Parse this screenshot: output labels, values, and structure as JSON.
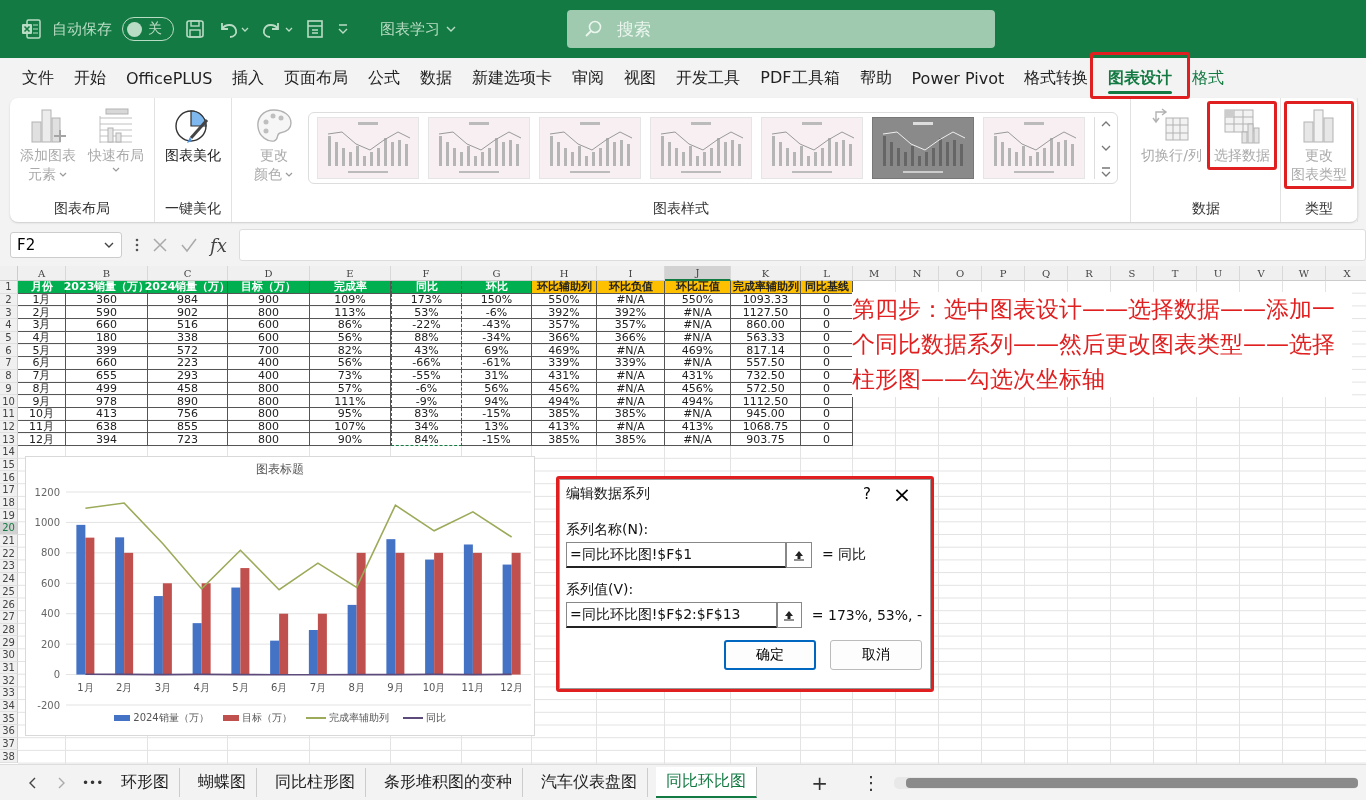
{
  "title_bar": {
    "autosave_label": "自动保存",
    "autosave_toggle": {
      "on": false,
      "label": "关"
    },
    "document_title": "图表学习",
    "search": {
      "placeholder": "搜索"
    }
  },
  "ribbon_tabs": [
    {
      "label": "文件",
      "selected": false,
      "contextual": false,
      "highlighted": false
    },
    {
      "label": "开始",
      "selected": false,
      "contextual": false,
      "highlighted": false
    },
    {
      "label": "OfficePLUS",
      "selected": false,
      "contextual": false,
      "highlighted": false
    },
    {
      "label": "插入",
      "selected": false,
      "contextual": false,
      "highlighted": false
    },
    {
      "label": "页面布局",
      "selected": false,
      "contextual": false,
      "highlighted": false
    },
    {
      "label": "公式",
      "selected": false,
      "contextual": false,
      "highlighted": false
    },
    {
      "label": "数据",
      "selected": false,
      "contextual": false,
      "highlighted": false
    },
    {
      "label": "新建选项卡",
      "selected": false,
      "contextual": false,
      "highlighted": false
    },
    {
      "label": "审阅",
      "selected": false,
      "contextual": false,
      "highlighted": false
    },
    {
      "label": "视图",
      "selected": false,
      "contextual": false,
      "highlighted": false
    },
    {
      "label": "开发工具",
      "selected": false,
      "contextual": false,
      "highlighted": false
    },
    {
      "label": "PDF工具箱",
      "selected": false,
      "contextual": false,
      "highlighted": false
    },
    {
      "label": "帮助",
      "selected": false,
      "contextual": false,
      "highlighted": false
    },
    {
      "label": "Power Pivot",
      "selected": false,
      "contextual": false,
      "highlighted": false
    },
    {
      "label": "格式转换",
      "selected": false,
      "contextual": false,
      "highlighted": false
    },
    {
      "label": "图表设计",
      "selected": true,
      "contextual": true,
      "highlighted": true
    },
    {
      "label": "格式",
      "selected": false,
      "contextual": true,
      "highlighted": false
    }
  ],
  "ribbon_groups": [
    {
      "label": "图表布局",
      "items": [
        {
          "kind": "add-element",
          "lines": [
            "添加图表",
            "元素"
          ],
          "disabled": true,
          "dropdown": true,
          "highlighted": false
        },
        {
          "kind": "quick-layout",
          "lines": [
            "快速布局"
          ],
          "disabled": true,
          "dropdown": true,
          "highlighted": false
        }
      ]
    },
    {
      "label": "一键美化",
      "items": [
        {
          "kind": "beautify",
          "lines": [
            "图表美化"
          ],
          "disabled": false,
          "dropdown": false,
          "highlighted": false
        }
      ]
    },
    {
      "label": "图表样式",
      "items": [
        {
          "kind": "colors",
          "lines": [
            "更改",
            "颜色"
          ],
          "disabled": true,
          "dropdown": true,
          "highlighted": false
        },
        {
          "kind": "gallery",
          "thumbnails": [
            {
              "dark": false
            },
            {
              "dark": false
            },
            {
              "dark": false
            },
            {
              "dark": false
            },
            {
              "dark": false
            },
            {
              "dark": true
            },
            {
              "dark": false
            }
          ]
        }
      ]
    },
    {
      "label": "数据",
      "items": [
        {
          "kind": "switch-row-col",
          "lines": [
            "切换行/列"
          ],
          "disabled": true,
          "dropdown": false,
          "highlighted": false
        },
        {
          "kind": "select-data",
          "lines": [
            "选择数据"
          ],
          "disabled": true,
          "dropdown": false,
          "highlighted": true
        }
      ]
    },
    {
      "label": "类型",
      "items": [
        {
          "kind": "change-type",
          "lines": [
            "更改",
            "图表类型"
          ],
          "disabled": true,
          "dropdown": false,
          "highlighted": true
        }
      ]
    }
  ],
  "formula_bar": {
    "name_box": "F2",
    "fx": "fx"
  },
  "columns": [
    {
      "label": "A",
      "selected": false
    },
    {
      "label": "B",
      "selected": false
    },
    {
      "label": "C",
      "selected": false
    },
    {
      "label": "D",
      "selected": false
    },
    {
      "label": "E",
      "selected": false
    },
    {
      "label": "F",
      "selected": false
    },
    {
      "label": "G",
      "selected": false
    },
    {
      "label": "H",
      "selected": false
    },
    {
      "label": "I",
      "selected": false
    },
    {
      "label": "J",
      "selected": true
    },
    {
      "label": "K",
      "selected": false
    },
    {
      "label": "L",
      "selected": false
    },
    {
      "label": "M",
      "selected": false
    },
    {
      "label": "N",
      "selected": false
    },
    {
      "label": "O",
      "selected": false
    },
    {
      "label": "P",
      "selected": false
    },
    {
      "label": "Q",
      "selected": false
    },
    {
      "label": "R",
      "selected": false
    },
    {
      "label": "S",
      "selected": false
    },
    {
      "label": "T",
      "selected": false
    },
    {
      "label": "U",
      "selected": false
    },
    {
      "label": "V",
      "selected": false
    },
    {
      "label": "W",
      "selected": false
    },
    {
      "label": "X",
      "selected": false
    }
  ],
  "row_numbers": [
    {
      "label": "1",
      "selected": false
    },
    {
      "label": "2",
      "selected": false
    },
    {
      "label": "3",
      "selected": false
    },
    {
      "label": "4",
      "selected": false
    },
    {
      "label": "5",
      "selected": false
    },
    {
      "label": "6",
      "selected": false
    },
    {
      "label": "7",
      "selected": false
    },
    {
      "label": "8",
      "selected": false
    },
    {
      "label": "9",
      "selected": false
    },
    {
      "label": "10",
      "selected": false
    },
    {
      "label": "11",
      "selected": false
    },
    {
      "label": "12",
      "selected": false
    },
    {
      "label": "13",
      "selected": false
    },
    {
      "label": "14",
      "selected": false
    },
    {
      "label": "15",
      "selected": false
    },
    {
      "label": "16",
      "selected": false
    },
    {
      "label": "17",
      "selected": false
    },
    {
      "label": "18",
      "selected": false
    },
    {
      "label": "19",
      "selected": false
    },
    {
      "label": "20",
      "selected": true
    },
    {
      "label": "21",
      "selected": false
    },
    {
      "label": "22",
      "selected": false
    },
    {
      "label": "23",
      "selected": false
    },
    {
      "label": "24",
      "selected": false
    },
    {
      "label": "25",
      "selected": false
    },
    {
      "label": "26",
      "selected": false
    },
    {
      "label": "27",
      "selected": false
    },
    {
      "label": "28",
      "selected": false
    },
    {
      "label": "29",
      "selected": false
    },
    {
      "label": "30",
      "selected": false
    },
    {
      "label": "31",
      "selected": false
    },
    {
      "label": "32",
      "selected": false
    },
    {
      "label": "33",
      "selected": false
    },
    {
      "label": "34",
      "selected": false
    },
    {
      "label": "35",
      "selected": false
    },
    {
      "label": "36",
      "selected": false
    },
    {
      "label": "37",
      "selected": false
    },
    {
      "label": "38",
      "selected": false
    }
  ],
  "table": {
    "header": [
      {
        "text": "月份",
        "color": "#00b050",
        "marquee": false
      },
      {
        "text": "2023销量（万）",
        "color": "#00b050",
        "marquee": false
      },
      {
        "text": "2024销量（万）",
        "color": "#00b050",
        "marquee": false
      },
      {
        "text": "目标（万）",
        "color": "#00b050",
        "marquee": false
      },
      {
        "text": "完成率",
        "color": "#00b050",
        "marquee": false
      },
      {
        "text": "同比",
        "color": "#00b050",
        "marquee": true
      },
      {
        "text": "环比",
        "color": "#00b050",
        "marquee": false
      },
      {
        "text": "环比辅助列",
        "color": "#ffc000",
        "marquee": false
      },
      {
        "text": "环比负值",
        "color": "#ffc000",
        "marquee": false
      },
      {
        "text": "环比正值",
        "color": "#ffc000",
        "marquee": false
      },
      {
        "text": "完成率辅助列",
        "color": "#ffc000",
        "marquee": false
      },
      {
        "text": "同比基线",
        "color": "#ffc000",
        "marquee": false
      }
    ],
    "rows": [
      [
        "1月",
        "360",
        "984",
        "900",
        "109%",
        "173%",
        "150%",
        "550%",
        "#N/A",
        "550%",
        "1093.33",
        "0"
      ],
      [
        "2月",
        "590",
        "902",
        "800",
        "113%",
        "53%",
        "-6%",
        "392%",
        "392%",
        "#N/A",
        "1127.50",
        "0"
      ],
      [
        "3月",
        "660",
        "516",
        "600",
        "86%",
        "-22%",
        "-43%",
        "357%",
        "357%",
        "#N/A",
        "860.00",
        "0"
      ],
      [
        "4月",
        "180",
        "338",
        "600",
        "56%",
        "88%",
        "-34%",
        "366%",
        "366%",
        "#N/A",
        "563.33",
        "0"
      ],
      [
        "5月",
        "399",
        "572",
        "700",
        "82%",
        "43%",
        "69%",
        "469%",
        "#N/A",
        "469%",
        "817.14",
        "0"
      ],
      [
        "6月",
        "660",
        "223",
        "400",
        "56%",
        "-66%",
        "-61%",
        "339%",
        "339%",
        "#N/A",
        "557.50",
        "0"
      ],
      [
        "7月",
        "655",
        "293",
        "400",
        "73%",
        "-55%",
        "31%",
        "431%",
        "#N/A",
        "431%",
        "732.50",
        "0"
      ],
      [
        "8月",
        "499",
        "458",
        "800",
        "57%",
        "-6%",
        "56%",
        "456%",
        "#N/A",
        "456%",
        "572.50",
        "0"
      ],
      [
        "9月",
        "978",
        "890",
        "800",
        "111%",
        "-9%",
        "94%",
        "494%",
        "#N/A",
        "494%",
        "1112.50",
        "0"
      ],
      [
        "10月",
        "413",
        "756",
        "800",
        "95%",
        "83%",
        "-15%",
        "385%",
        "385%",
        "#N/A",
        "945.00",
        "0"
      ],
      [
        "11月",
        "638",
        "855",
        "800",
        "107%",
        "34%",
        "13%",
        "413%",
        "#N/A",
        "413%",
        "1068.75",
        "0"
      ],
      [
        "12月",
        "394",
        "723",
        "800",
        "90%",
        "84%",
        "-15%",
        "385%",
        "385%",
        "#N/A",
        "903.75",
        "0"
      ]
    ]
  },
  "annotation": "第四步：选中图表设计——选择数据——添加一个同比数据系列——然后更改图表类型——选择柱形图——勾选次坐标轴",
  "chart": {
    "chart_data": {
      "type": "bar",
      "title": "图表标题",
      "categories": [
        "1月",
        "2月",
        "3月",
        "4月",
        "5月",
        "6月",
        "7月",
        "8月",
        "9月",
        "10月",
        "11月",
        "12月"
      ],
      "ylim": [
        -200,
        1200
      ],
      "grid": true,
      "legend": true,
      "yticks": [
        {
          "value": -200,
          "label": "-200"
        },
        {
          "value": 0,
          "label": "0"
        },
        {
          "value": 200,
          "label": "200"
        },
        {
          "value": 400,
          "label": "400"
        },
        {
          "value": 600,
          "label": "600"
        },
        {
          "value": 800,
          "label": "800"
        },
        {
          "value": 1000,
          "label": "1000"
        },
        {
          "value": 1200,
          "label": "1200"
        }
      ],
      "series": [
        {
          "name": "2024销量（万）",
          "type": "bar",
          "color": "#4472c4",
          "values": [
            984,
            902,
            516,
            338,
            572,
            223,
            293,
            458,
            890,
            756,
            855,
            723
          ]
        },
        {
          "name": "目标（万）",
          "type": "bar",
          "color": "#c0504d",
          "values": [
            900,
            800,
            600,
            600,
            700,
            400,
            400,
            800,
            800,
            800,
            800,
            800
          ]
        },
        {
          "name": "完成率辅助列",
          "type": "line",
          "color": "#9bab5a",
          "values": [
            1093,
            1128,
            860,
            563,
            817,
            558,
            733,
            573,
            1113,
            945,
            1069,
            904
          ]
        },
        {
          "name": "同比",
          "type": "line",
          "color": "#5b4a7a",
          "values": [
            2,
            1,
            0,
            1,
            0,
            -1,
            -1,
            0,
            0,
            1,
            0,
            1
          ]
        }
      ]
    }
  },
  "dialog": {
    "title": "编辑数据系列",
    "help": "?",
    "close": "×",
    "highlighted": true,
    "fields": [
      {
        "label": "系列名称(N):",
        "value": "=同比环比图!$F$1",
        "preview": "= 同比"
      },
      {
        "label": "系列值(V):",
        "value": "=同比环比图!$F$2:$F$13",
        "preview": "= 173%, 53%, -"
      }
    ],
    "buttons": [
      {
        "label": "确定",
        "default": true
      },
      {
        "label": "取消",
        "default": false
      }
    ]
  },
  "sheet_tabs": {
    "more": "•••",
    "tabs": [
      {
        "label": "环形图",
        "selected": false
      },
      {
        "label": "蝴蝶图",
        "selected": false
      },
      {
        "label": "同比柱形图",
        "selected": false
      },
      {
        "label": "条形堆积图的变种",
        "selected": false
      },
      {
        "label": "汽车仪表盘图",
        "selected": false
      },
      {
        "label": "同比环比图",
        "selected": true
      }
    ],
    "add": "+",
    "menu": "⋮"
  }
}
